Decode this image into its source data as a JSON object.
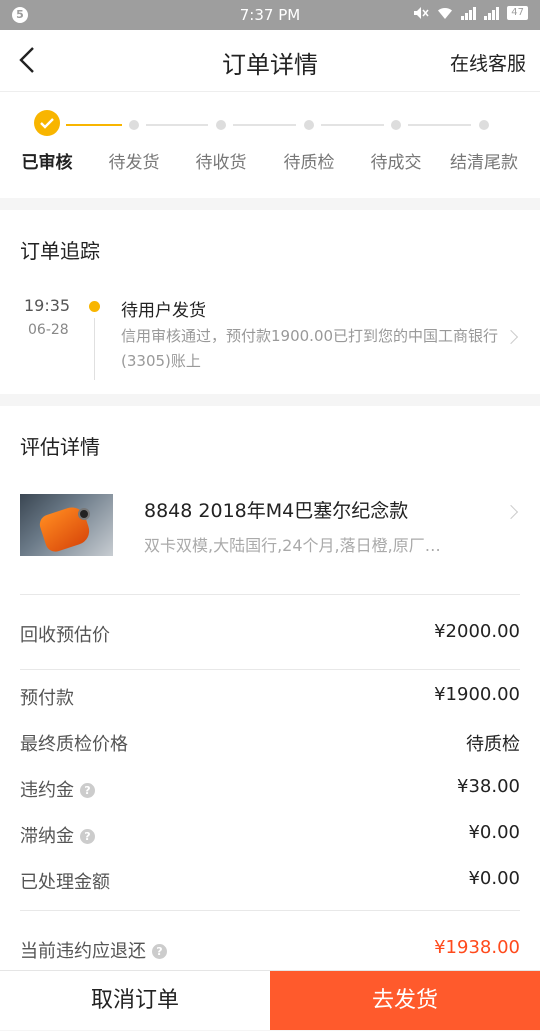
{
  "status_bar": {
    "left_badge": "5",
    "time": "7:37 PM",
    "battery": "47"
  },
  "header": {
    "title": "订单详情",
    "service_label": "在线客服"
  },
  "progress": {
    "steps": [
      "已审核",
      "待发货",
      "待收货",
      "待质检",
      "待成交",
      "结清尾款"
    ],
    "current_index": 0,
    "accent_color": "#f8b500"
  },
  "tracking": {
    "title": "订单追踪",
    "entry": {
      "time": "19:35",
      "date": "06-28",
      "headline": "待用户发货",
      "detail": "信用审核通过，预付款1900.00已打到您的中国工商银行(3305)账上"
    }
  },
  "evaluation": {
    "title": "评估详情",
    "product": {
      "name": "8848 2018年M4巴塞尔纪念款",
      "spec": "双卡双模,大陆国行,24个月,落日橙,原厂…"
    },
    "estimate": {
      "label": "回收预估价",
      "value": "¥2000.00"
    },
    "rows": [
      {
        "label": "预付款",
        "value": "¥1900.00"
      },
      {
        "label": "最终质检价格",
        "value": "待质检"
      },
      {
        "label": "违约金",
        "value": "¥38.00"
      },
      {
        "label": "滞纳金",
        "value": "¥0.00"
      },
      {
        "label": "已处理金额",
        "value": "¥0.00"
      }
    ],
    "refund": {
      "label": "当前违约应退还",
      "value": "¥1938.00",
      "value_color": "#ff4a1c"
    },
    "help_glyph": "?"
  },
  "actions": {
    "cancel": "取消订单",
    "ship": "去发货",
    "ship_color": "#ff5a2c"
  }
}
